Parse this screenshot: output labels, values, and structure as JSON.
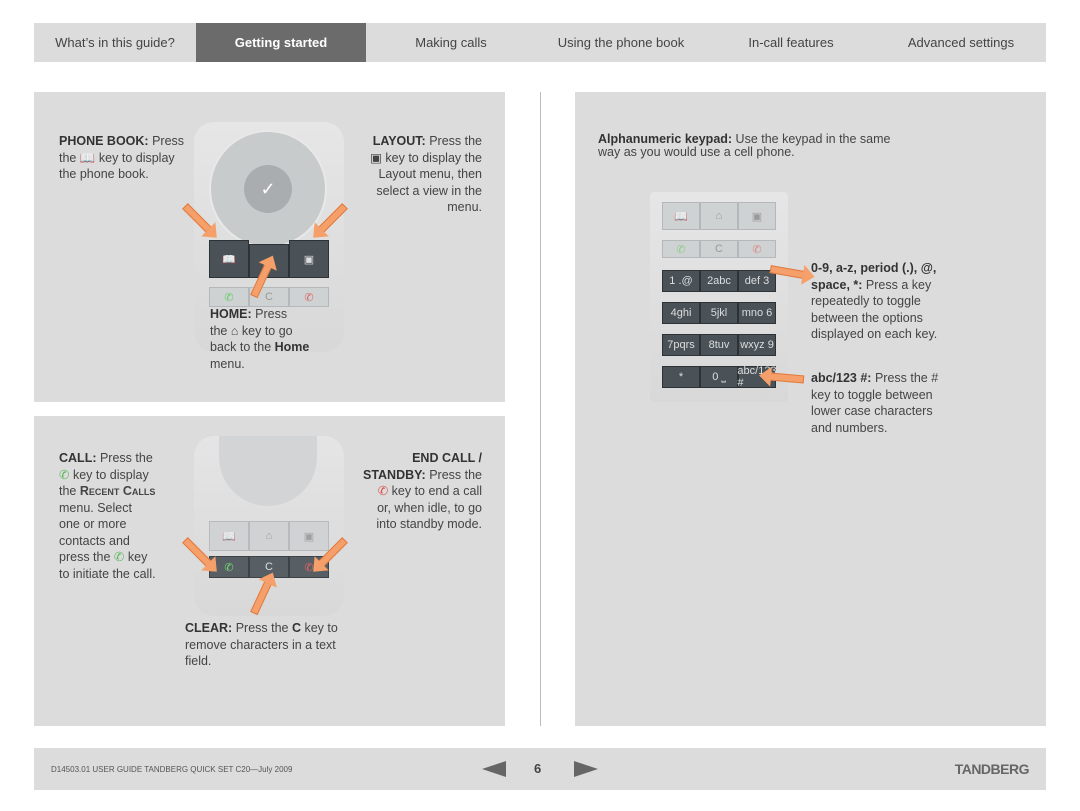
{
  "nav": {
    "tabs": [
      {
        "label": "What’s in this guide?",
        "active": false
      },
      {
        "label": "Getting started",
        "active": true
      },
      {
        "label": "Making calls",
        "active": false
      },
      {
        "label": "Using the phone book",
        "active": false
      },
      {
        "label": "In-call features",
        "active": false
      },
      {
        "label": "Advanced settings",
        "active": false
      }
    ]
  },
  "top_panel": {
    "phonebook": {
      "title": "PHONE BOOK:",
      "t1": " Press",
      "t2": "the",
      "t3": " key to display",
      "t4": "the phone book."
    },
    "layout": {
      "title": "LAYOUT:",
      "t1": " Press the",
      "t2": " key to display the",
      "t3": "Layout menu, then",
      "t4": "select a view in the",
      "t5": "menu."
    },
    "home": {
      "title": "HOME:",
      "t1": " Press",
      "t2": "the",
      "t3": " key to go",
      "t4": "back to the ",
      "t5": "Home",
      "t6": "menu."
    }
  },
  "bottom_panel": {
    "call": {
      "title": "CALL:",
      "t1": " Press the",
      "t2": " key to display",
      "t3": "the ",
      "t4": "Recent Calls",
      "t5": "menu. Select",
      "t6": "one or more",
      "t7": "contacts and",
      "t8": "press the",
      "t9": " key",
      "t10": "to initiate the call."
    },
    "endcall": {
      "title1": "END CALL /",
      "title2": "STANDBY:",
      "t1": " Press the",
      "t2": " key to end a call",
      "t3": "or, when idle, to go",
      "t4": "into standby mode."
    },
    "clear": {
      "title": "CLEAR:",
      "t1": " Press the ",
      "key": "C",
      "t2": " key to",
      "t3": "remove characters in a text",
      "t4": "field."
    }
  },
  "right_panel": {
    "intro": {
      "title": "Alphanumeric keypad:",
      "t1": " Use the keypad in the same",
      "t2": "way as you would use a cell phone."
    },
    "chars": {
      "title1": "0-9, a-z, period (.), @,",
      "title2": "space, *:",
      "t1": "  Press a key",
      "t2": "repeatedly to toggle",
      "t3": "between the options",
      "t4": "displayed on each key."
    },
    "abc": {
      "title": "abc/123 #:",
      "t1": " Press the #",
      "t2": "key to toggle between",
      "t3": "lower case characters",
      "t4": "and numbers."
    },
    "keys": [
      "1 .@",
      "2abc",
      "def 3",
      "4ghi",
      "5jkl",
      "mno 6",
      "7pqrs",
      "8tuv",
      "wxyz 9",
      "*",
      "0 ⎵",
      "abc/123 #"
    ],
    "clear_key": "C"
  },
  "footer": {
    "doc": "D14503.01 USER GUIDE TANDBERG QUICK SET C20—July 2009",
    "page": "6",
    "logo": "TANDBERG"
  },
  "colors": {
    "active_tab": "#6b6b6b",
    "panel": "#dcdcdc",
    "arrow": "#f5a06a",
    "call_green": "#5cb85c",
    "end_red": "#d9534f"
  }
}
